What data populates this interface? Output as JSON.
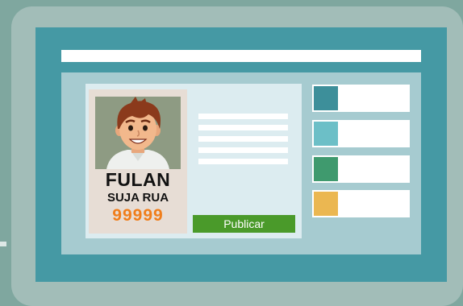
{
  "profile": {
    "name": "FULAN",
    "street": "SUJA RUA",
    "number": "99999"
  },
  "actions": {
    "publish_label": "Publicar"
  },
  "palette": {
    "background": "#7fa79f",
    "bezel": "#a2bdb8",
    "screen": "#4599a4",
    "accent_button": "#4a9a2a",
    "number_color": "#f07d1a"
  },
  "list_items": [
    {
      "swatch_color": "#3d8f9a"
    },
    {
      "swatch_color": "#6cbfc7"
    },
    {
      "swatch_color": "#3f9a6e"
    },
    {
      "swatch_color": "#ebb751"
    }
  ]
}
